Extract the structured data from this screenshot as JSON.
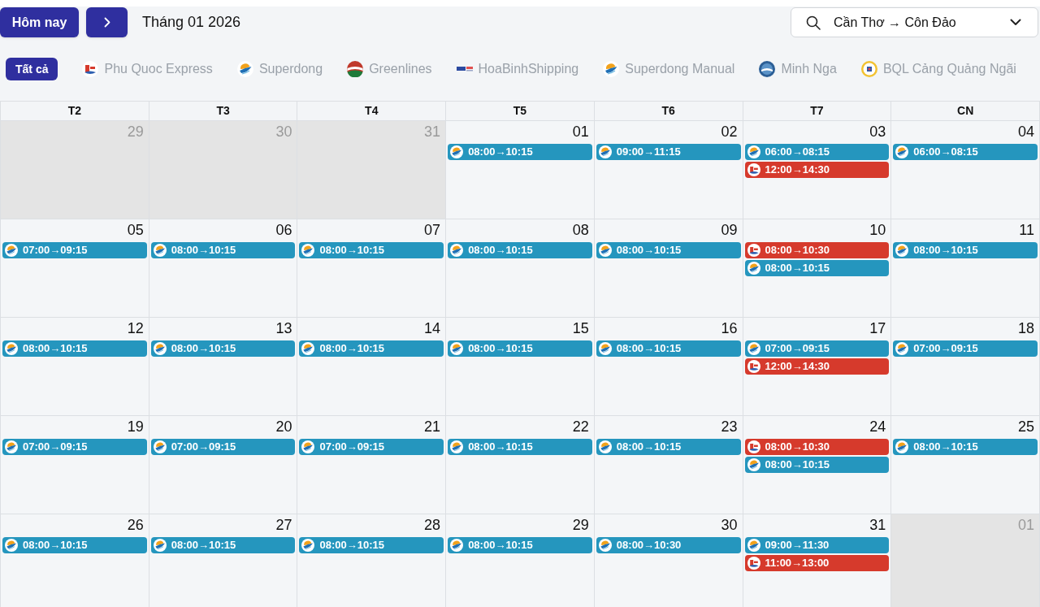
{
  "toolbar": {
    "today_button": "Hôm nay",
    "title": "Tháng 01 2026",
    "route_select": {
      "value": "Cần Thơ → Côn Đảo"
    }
  },
  "filters": [
    {
      "label": "Tất cả",
      "selected": true,
      "kind": "all"
    },
    {
      "label": "Phu Quoc Express",
      "selected": false,
      "kind": "emblem"
    },
    {
      "label": "Superdong",
      "selected": false,
      "kind": "swoosh"
    },
    {
      "label": "Greenlines",
      "selected": false,
      "kind": "stripes"
    },
    {
      "label": "HoaBinhShipping",
      "selected": false,
      "kind": "bars"
    },
    {
      "label": "Superdong Manual",
      "selected": false,
      "kind": "swoosh"
    },
    {
      "label": "Minh Nga",
      "selected": false,
      "kind": "globe"
    },
    {
      "label": "BQL Cảng Quảng Ngãi",
      "selected": false,
      "kind": "seal"
    }
  ],
  "calendar": {
    "weekdays": [
      "T2",
      "T3",
      "T4",
      "T5",
      "T6",
      "T7",
      "CN"
    ],
    "weeks": [
      {
        "days": [
          {
            "date": "29",
            "outside_month": true
          },
          {
            "date": "30",
            "outside_month": true
          },
          {
            "date": "31",
            "outside_month": true
          },
          {
            "date": "01",
            "outside_month": false,
            "events": [
              {
                "time": "08:00→10:15",
                "color": "#2596be",
                "kind": "swoosh"
              }
            ]
          },
          {
            "date": "02",
            "outside_month": false,
            "events": [
              {
                "time": "09:00→11:15",
                "color": "#2596be",
                "kind": "swoosh"
              }
            ]
          },
          {
            "date": "03",
            "outside_month": false,
            "events": [
              {
                "time": "06:00→08:15",
                "color": "#2596be",
                "kind": "swoosh"
              },
              {
                "time": "12:00→14:30",
                "color": "#d63a2c",
                "kind": "emblem"
              }
            ]
          },
          {
            "date": "04",
            "outside_month": false,
            "events": [
              {
                "time": "06:00→08:15",
                "color": "#2596be",
                "kind": "swoosh"
              }
            ]
          }
        ]
      },
      {
        "days": [
          {
            "date": "05",
            "outside_month": false,
            "events": [
              {
                "time": "07:00→09:15",
                "color": "#2596be",
                "kind": "swoosh"
              }
            ]
          },
          {
            "date": "06",
            "outside_month": false,
            "events": [
              {
                "time": "08:00→10:15",
                "color": "#2596be",
                "kind": "swoosh"
              }
            ]
          },
          {
            "date": "07",
            "outside_month": false,
            "events": [
              {
                "time": "08:00→10:15",
                "color": "#2596be",
                "kind": "swoosh"
              }
            ]
          },
          {
            "date": "08",
            "outside_month": false,
            "events": [
              {
                "time": "08:00→10:15",
                "color": "#2596be",
                "kind": "swoosh"
              }
            ]
          },
          {
            "date": "09",
            "outside_month": false,
            "events": [
              {
                "time": "08:00→10:15",
                "color": "#2596be",
                "kind": "swoosh"
              }
            ]
          },
          {
            "date": "10",
            "outside_month": false,
            "events": [
              {
                "time": "08:00→10:30",
                "color": "#d63a2c",
                "kind": "emblem"
              },
              {
                "time": "08:00→10:15",
                "color": "#2596be",
                "kind": "swoosh"
              }
            ]
          },
          {
            "date": "11",
            "outside_month": false,
            "events": [
              {
                "time": "08:00→10:15",
                "color": "#2596be",
                "kind": "swoosh"
              }
            ]
          }
        ]
      },
      {
        "days": [
          {
            "date": "12",
            "outside_month": false,
            "events": [
              {
                "time": "08:00→10:15",
                "color": "#2596be",
                "kind": "swoosh"
              }
            ]
          },
          {
            "date": "13",
            "outside_month": false,
            "events": [
              {
                "time": "08:00→10:15",
                "color": "#2596be",
                "kind": "swoosh"
              }
            ]
          },
          {
            "date": "14",
            "outside_month": false,
            "events": [
              {
                "time": "08:00→10:15",
                "color": "#2596be",
                "kind": "swoosh"
              }
            ]
          },
          {
            "date": "15",
            "outside_month": false,
            "events": [
              {
                "time": "08:00→10:15",
                "color": "#2596be",
                "kind": "swoosh"
              }
            ]
          },
          {
            "date": "16",
            "outside_month": false,
            "events": [
              {
                "time": "08:00→10:15",
                "color": "#2596be",
                "kind": "swoosh"
              }
            ]
          },
          {
            "date": "17",
            "outside_month": false,
            "events": [
              {
                "time": "07:00→09:15",
                "color": "#2596be",
                "kind": "swoosh"
              },
              {
                "time": "12:00→14:30",
                "color": "#d63a2c",
                "kind": "emblem"
              }
            ]
          },
          {
            "date": "18",
            "outside_month": false,
            "events": [
              {
                "time": "07:00→09:15",
                "color": "#2596be",
                "kind": "swoosh"
              }
            ]
          }
        ]
      },
      {
        "days": [
          {
            "date": "19",
            "outside_month": false,
            "events": [
              {
                "time": "07:00→09:15",
                "color": "#2596be",
                "kind": "swoosh"
              }
            ]
          },
          {
            "date": "20",
            "outside_month": false,
            "events": [
              {
                "time": "07:00→09:15",
                "color": "#2596be",
                "kind": "swoosh"
              }
            ]
          },
          {
            "date": "21",
            "outside_month": false,
            "events": [
              {
                "time": "07:00→09:15",
                "color": "#2596be",
                "kind": "swoosh"
              }
            ]
          },
          {
            "date": "22",
            "outside_month": false,
            "events": [
              {
                "time": "08:00→10:15",
                "color": "#2596be",
                "kind": "swoosh"
              }
            ]
          },
          {
            "date": "23",
            "outside_month": false,
            "events": [
              {
                "time": "08:00→10:15",
                "color": "#2596be",
                "kind": "swoosh"
              }
            ]
          },
          {
            "date": "24",
            "outside_month": false,
            "events": [
              {
                "time": "08:00→10:30",
                "color": "#d63a2c",
                "kind": "emblem"
              },
              {
                "time": "08:00→10:15",
                "color": "#2596be",
                "kind": "swoosh"
              }
            ]
          },
          {
            "date": "25",
            "outside_month": false,
            "events": [
              {
                "time": "08:00→10:15",
                "color": "#2596be",
                "kind": "swoosh"
              }
            ]
          }
        ]
      },
      {
        "days": [
          {
            "date": "26",
            "outside_month": false,
            "events": [
              {
                "time": "08:00→10:15",
                "color": "#2596be",
                "kind": "swoosh"
              }
            ]
          },
          {
            "date": "27",
            "outside_month": false,
            "events": [
              {
                "time": "08:00→10:15",
                "color": "#2596be",
                "kind": "swoosh"
              }
            ]
          },
          {
            "date": "28",
            "outside_month": false,
            "events": [
              {
                "time": "08:00→10:15",
                "color": "#2596be",
                "kind": "swoosh"
              }
            ]
          },
          {
            "date": "29",
            "outside_month": false,
            "events": [
              {
                "time": "08:00→10:15",
                "color": "#2596be",
                "kind": "swoosh"
              }
            ]
          },
          {
            "date": "30",
            "outside_month": false,
            "events": [
              {
                "time": "08:00→10:30",
                "color": "#2596be",
                "kind": "swoosh"
              }
            ]
          },
          {
            "date": "31",
            "outside_month": false,
            "events": [
              {
                "time": "09:00→11:30",
                "color": "#2596be",
                "kind": "swoosh"
              },
              {
                "time": "11:00→13:00",
                "color": "#d63a2c",
                "kind": "emblem"
              }
            ]
          },
          {
            "date": "01",
            "outside_month": true
          }
        ]
      }
    ]
  }
}
